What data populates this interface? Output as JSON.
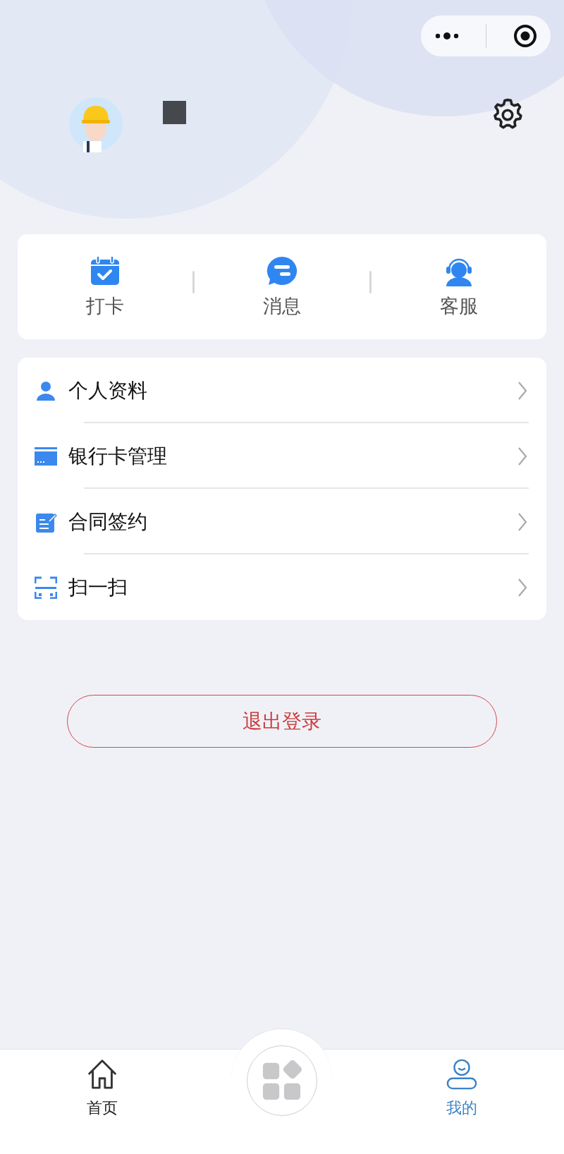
{
  "quick_actions": [
    {
      "kind": "checkin",
      "label": "打卡"
    },
    {
      "kind": "message",
      "label": "消息"
    },
    {
      "kind": "service",
      "label": "客服"
    }
  ],
  "menu": [
    {
      "kind": "profile",
      "label": "个人资料"
    },
    {
      "kind": "bankcard",
      "label": "银行卡管理"
    },
    {
      "kind": "contract",
      "label": "合同签约"
    },
    {
      "kind": "scan",
      "label": "扫一扫"
    }
  ],
  "logout_button": "退出登录",
  "tab_bar": [
    {
      "kind": "home",
      "label": "首页",
      "selected": false
    },
    {
      "kind": "mine",
      "label": "我的",
      "selected": true
    }
  ]
}
